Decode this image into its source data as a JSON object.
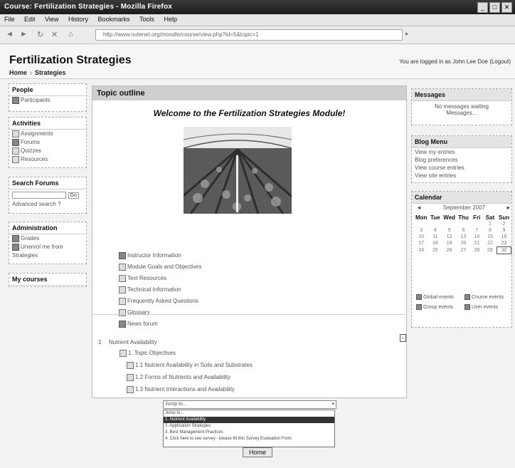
{
  "window": {
    "title": "Course: Fertilization Strategies - Mozilla Firefox"
  },
  "menu": [
    "File",
    "Edit",
    "View",
    "History",
    "Bookmarks",
    "Tools",
    "Help"
  ],
  "url": "http://www.nutenet.org/moodle/course/view.php?id=5&topic=1",
  "header": {
    "title": "Fertilization Strategies",
    "breadcrumb": [
      "Home",
      "Strategies"
    ],
    "login": "You are logged in as John Lee Doe (Logout)"
  },
  "left": {
    "people": {
      "title": "People",
      "items": [
        "Participants"
      ]
    },
    "activities": {
      "title": "Activities",
      "items": [
        "Assignments",
        "Forums",
        "Quizzes",
        "Resources"
      ]
    },
    "search": {
      "title": "Search Forums",
      "go": "Go",
      "advanced": "Advanced search"
    },
    "admin": {
      "title": "Administration",
      "items": [
        "Grades",
        "Unenrol me from",
        "Strategies"
      ]
    },
    "mycourses": {
      "title": "My courses"
    }
  },
  "center": {
    "outline_title": "Topic outline",
    "welcome": "Welcome to the Fertilization Strategies Module!",
    "resources": [
      "Instructor Information",
      "Module Goals and Objectives",
      "Text Resources",
      "Technical Information",
      "Frequently Asked Questions",
      "Glossary",
      "News forum"
    ],
    "topic_number": "1",
    "topic_title": "Nutrient Availability",
    "topic_items": [
      "1.  Topic Objectives",
      "1.1 Nutrient Availability in Soils and Substrates",
      "1.2 Forms of Nutrients and Availability",
      "1.3 Nutrient Interactions and Availability"
    ]
  },
  "jump": {
    "label": "Jump to...",
    "options": [
      "Jump to...",
      "1. Nutrient Availability",
      "2. Application Strategies",
      "3. Best Management Practices",
      "4. Click here to see survey  -  please fill this Survey Evaluation Form"
    ],
    "selected_index": 1
  },
  "home_button": "Home",
  "right": {
    "messages": {
      "title": "Messages",
      "text1": "No messages waiting",
      "link": "Messages..."
    },
    "blog": {
      "title": "Blog Menu",
      "items": [
        "View my entries",
        "Blog preferences",
        "View course entries",
        "View site entries"
      ]
    },
    "calendar": {
      "title": "Calendar",
      "month": "September 2007",
      "prev": "◄",
      "next": "►",
      "days": [
        "Mon",
        "Tue",
        "Wed",
        "Thu",
        "Fri",
        "Sat",
        "Sun"
      ],
      "weeks": [
        [
          "",
          "",
          "",
          "",
          "",
          "1",
          "2"
        ],
        [
          "3",
          "4",
          "5",
          "6",
          "7",
          "8",
          "9"
        ],
        [
          "10",
          "11",
          "12",
          "13",
          "14",
          "15",
          "16"
        ],
        [
          "17",
          "18",
          "19",
          "20",
          "21",
          "22",
          "23"
        ],
        [
          "24",
          "25",
          "26",
          "27",
          "28",
          "29",
          "30"
        ]
      ],
      "today": "30",
      "legend": [
        "Global events",
        "Course events",
        "Group events",
        "User events"
      ]
    }
  },
  "colors": {
    "header_bar": "#cfcfcf",
    "page_bg": "#f2f2f2",
    "title_bar": "#1c1c1c"
  }
}
